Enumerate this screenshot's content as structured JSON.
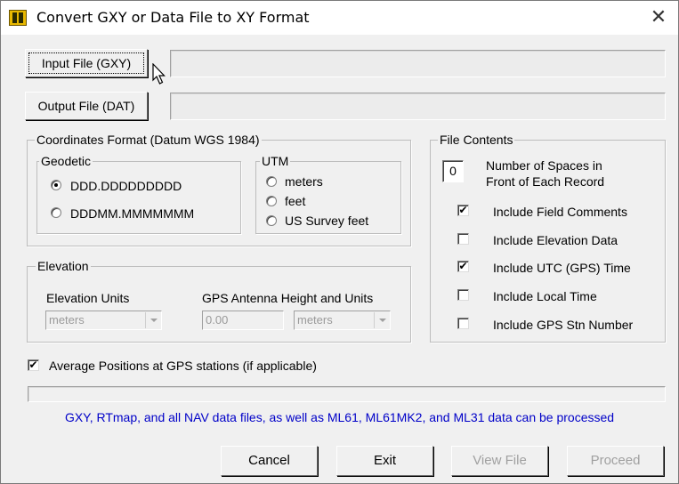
{
  "window": {
    "title": "Convert GXY or Data File to XY Format",
    "close": "✕"
  },
  "files": {
    "input_button": "Input File (GXY)",
    "input_path": "",
    "output_button": "Output File (DAT)",
    "output_path": ""
  },
  "coords": {
    "legend": "Coordinates Format (Datum WGS 1984)",
    "geodetic": {
      "legend": "Geodetic",
      "options": [
        "DDD.DDDDDDDDD",
        "DDDMM.MMMMMMM"
      ],
      "selected": 0
    },
    "utm": {
      "legend": "UTM",
      "options": [
        "meters",
        "feet",
        "US Survey feet"
      ]
    }
  },
  "elevation": {
    "legend": "Elevation",
    "units_label": "Elevation Units",
    "units_value": "meters",
    "antenna_label": "GPS Antenna Height and Units",
    "antenna_value": "0.00",
    "antenna_units": "meters"
  },
  "contents": {
    "legend": "File Contents",
    "spaces_value": "0",
    "spaces_label_1": "Number of Spaces in",
    "spaces_label_2": "Front of Each Record",
    "options": [
      {
        "label": "Include Field Comments",
        "checked": true
      },
      {
        "label": "Include Elevation Data",
        "checked": false
      },
      {
        "label": "Include UTC (GPS) Time",
        "checked": true
      },
      {
        "label": "Include Local Time",
        "checked": false
      },
      {
        "label": "Include GPS Stn Number",
        "checked": false
      }
    ],
    "check_glyph": "✔"
  },
  "average": {
    "label": "Average Positions at GPS stations (if applicable)",
    "checked": true
  },
  "progress": 0,
  "info": "GXY, RTmap, and all NAV data files, as well as ML61, ML61MK2, and ML31 data can be processed",
  "buttons": {
    "cancel": "Cancel",
    "exit": "Exit",
    "view": "View File",
    "proceed": "Proceed"
  },
  "colors": {
    "info_text": "#0000c8",
    "window_bg": "#f0f0f0",
    "icon_yellow": "#e8b800"
  }
}
